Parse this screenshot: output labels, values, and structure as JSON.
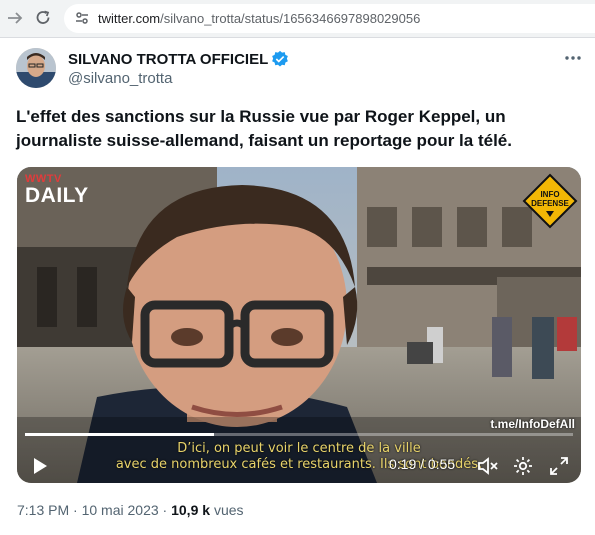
{
  "browser": {
    "url_host": "twitter.com",
    "url_path": "/silvano_trotta/status/1656346697898029056"
  },
  "tweet": {
    "display_name": "SILVANO TROTTA OFFICIEL",
    "handle": "@silvano_trotta",
    "text": "L'effet des sanctions sur la Russie vue par Roger Keppel, un journaliste suisse-allemand, faisant un reportage pour la télé.",
    "time": "7:13 PM",
    "date": "10 mai 2023",
    "views_count": "10,9 k",
    "views_label": "vues",
    "separator": "·"
  },
  "video": {
    "logo_small": "WWTV",
    "logo_big": "DAILY",
    "badge_line1": "INFO",
    "badge_line2": "DEFENSE",
    "watermark": "t.me/InfoDefAll",
    "subtitle_line1": "D’ici, on peut voir le centre de la ville",
    "subtitle_line2": "avec de nombreux cafés et restaurants. Ils sont bondés.",
    "current_time": "0:19",
    "duration": "0:55",
    "time_separator": "/",
    "progress": 0.345
  },
  "icons": {
    "back": "arrow-right-icon",
    "reload": "reload-icon",
    "site_info": "site-info-icon",
    "verified": "verified-badge-icon",
    "more": "more-icon",
    "play": "play-icon",
    "mute": "muted-speaker-icon",
    "settings": "gear-icon",
    "fullscreen": "fullscreen-icon"
  },
  "colors": {
    "verified": "#1d9bf0",
    "secondary_text": "#536471",
    "subtitle": "#e8d36a",
    "badge": "#f2b705"
  }
}
